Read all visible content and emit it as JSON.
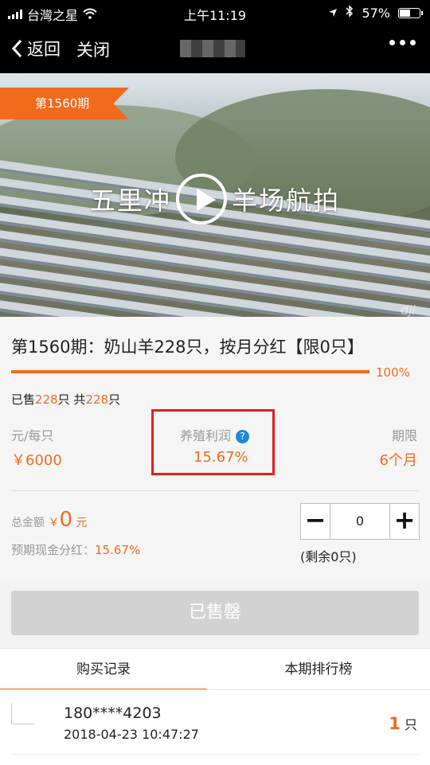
{
  "status_bar": {
    "carrier": "台灣之星",
    "time": "上午11:19",
    "battery": "57%",
    "battery_level": 0.57
  },
  "nav": {
    "back_label": "返回",
    "close_label": "关闭"
  },
  "banner": {
    "period_badge": "第1560期",
    "video_caption_left": "五里冲",
    "video_caption_right": "羊场航拍",
    "watermark": "dji"
  },
  "product": {
    "title": "第1560期：奶山羊228只，按月分红【限0只】",
    "progress_label": "100%",
    "progress": 1.0,
    "sold_prefix": "已售",
    "sold_count": "228",
    "sold_mid": "只 共",
    "total_count": "228",
    "sold_suffix": "只"
  },
  "stats": {
    "price_label": "元/每只",
    "price_value": "￥6000",
    "profit_label": "养殖利润",
    "profit_help": "?",
    "profit_value": "15.67%",
    "term_label": "期限",
    "term_value": "6个月"
  },
  "purchase": {
    "total_label": "总金额",
    "currency": "￥",
    "total_amount": "0",
    "total_unit": "元",
    "expect_label": "预期现金分红：",
    "expect_value": "15.67%",
    "minus": "−",
    "quantity": "0",
    "plus": "+",
    "remaining": "(剩余0只)"
  },
  "sold_out_button": "已售罄",
  "tabs": {
    "records": "购买记录",
    "ranking": "本期排行榜"
  },
  "records": [
    {
      "phone": "180****4203",
      "time": "2018-04-23 10:47:27",
      "count": "1",
      "unit": "只"
    }
  ],
  "colors": {
    "accent": "#f26b1d",
    "highlight_box": "#e51e1e",
    "help_icon": "#1e88d9"
  }
}
